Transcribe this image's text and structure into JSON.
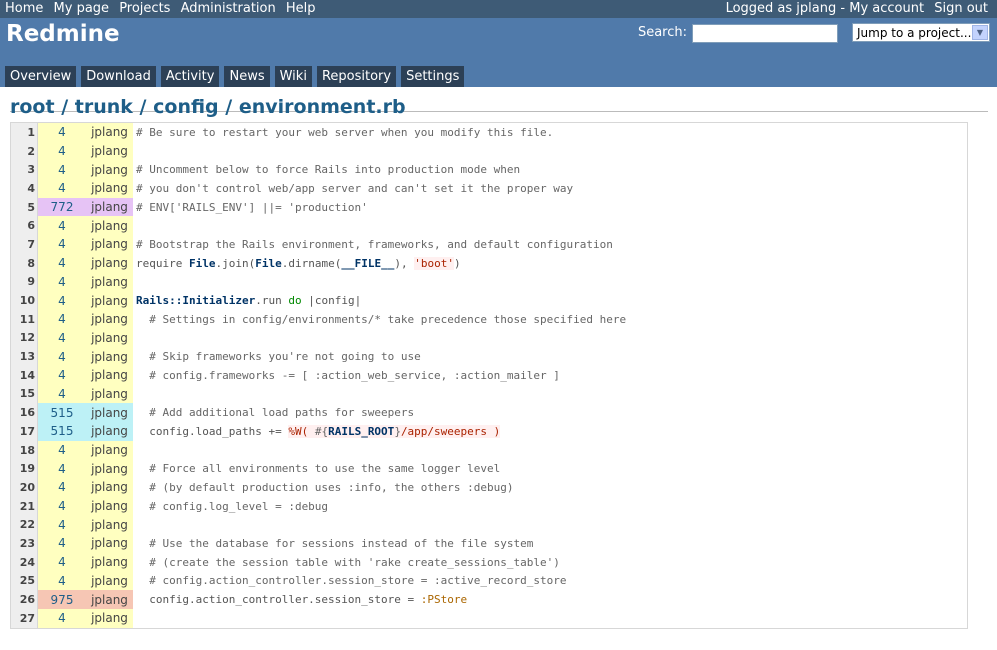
{
  "top_menu": {
    "left": [
      "Home",
      "My page",
      "Projects",
      "Administration",
      "Help"
    ],
    "logged_as": "Logged as jplang",
    "my_account": "My account",
    "sign_out": "Sign out"
  },
  "header": {
    "title": "Redmine",
    "search_label": "Search:",
    "search_value": "",
    "jump_label": "Jump to a project..."
  },
  "main_menu": [
    "Overview",
    "Download",
    "Activity",
    "News",
    "Wiki",
    "Repository",
    "Settings"
  ],
  "breadcrumb": [
    "root",
    "trunk",
    "config",
    "environment.rb"
  ],
  "colors": {
    "top": "#3e5b76",
    "header": "#507aaa",
    "tab": "#2c4056"
  },
  "lines": [
    {
      "n": "1",
      "rev": "4",
      "author": "jplang",
      "code": "# Be sure to restart your web server when you modify this file."
    },
    {
      "n": "2",
      "rev": "4",
      "author": "jplang",
      "code": ""
    },
    {
      "n": "3",
      "rev": "4",
      "author": "jplang",
      "code": "# Uncomment below to force Rails into production mode when"
    },
    {
      "n": "4",
      "rev": "4",
      "author": "jplang",
      "code": "# you don't control web/app server and can't set it the proper way"
    },
    {
      "n": "5",
      "rev": "772",
      "author": "jplang",
      "code": "# ENV['RAILS_ENV'] ||= 'production'"
    },
    {
      "n": "6",
      "rev": "4",
      "author": "jplang",
      "code": ""
    },
    {
      "n": "7",
      "rev": "4",
      "author": "jplang",
      "code": "# Bootstrap the Rails environment, frameworks, and default configuration"
    },
    {
      "n": "8",
      "rev": "4",
      "author": "jplang",
      "code": "require File.join(File.dirname(__FILE__), 'boot')"
    },
    {
      "n": "9",
      "rev": "4",
      "author": "jplang",
      "code": ""
    },
    {
      "n": "10",
      "rev": "4",
      "author": "jplang",
      "code": "Rails::Initializer.run do |config|"
    },
    {
      "n": "11",
      "rev": "4",
      "author": "jplang",
      "code": "  # Settings in config/environments/* take precedence those specified here"
    },
    {
      "n": "12",
      "rev": "4",
      "author": "jplang",
      "code": ""
    },
    {
      "n": "13",
      "rev": "4",
      "author": "jplang",
      "code": "  # Skip frameworks you're not going to use"
    },
    {
      "n": "14",
      "rev": "4",
      "author": "jplang",
      "code": "  # config.frameworks -= [ :action_web_service, :action_mailer ]"
    },
    {
      "n": "15",
      "rev": "4",
      "author": "jplang",
      "code": ""
    },
    {
      "n": "16",
      "rev": "515",
      "author": "jplang",
      "code": "  # Add additional load paths for sweepers"
    },
    {
      "n": "17",
      "rev": "515",
      "author": "jplang",
      "code": "  config.load_paths += %W( #{RAILS_ROOT}/app/sweepers )"
    },
    {
      "n": "18",
      "rev": "4",
      "author": "jplang",
      "code": ""
    },
    {
      "n": "19",
      "rev": "4",
      "author": "jplang",
      "code": "  # Force all environments to use the same logger level"
    },
    {
      "n": "20",
      "rev": "4",
      "author": "jplang",
      "code": "  # (by default production uses :info, the others :debug)"
    },
    {
      "n": "21",
      "rev": "4",
      "author": "jplang",
      "code": "  # config.log_level = :debug"
    },
    {
      "n": "22",
      "rev": "4",
      "author": "jplang",
      "code": ""
    },
    {
      "n": "23",
      "rev": "4",
      "author": "jplang",
      "code": "  # Use the database for sessions instead of the file system"
    },
    {
      "n": "24",
      "rev": "4",
      "author": "jplang",
      "code": "  # (create the session table with 'rake create_sessions_table')"
    },
    {
      "n": "25",
      "rev": "4",
      "author": "jplang",
      "code": "  # config.action_controller.session_store = :active_record_store"
    },
    {
      "n": "26",
      "rev": "975",
      "author": "jplang",
      "code": "  config.action_controller.session_store = :PStore"
    },
    {
      "n": "27",
      "rev": "4",
      "author": "jplang",
      "code": ""
    }
  ]
}
